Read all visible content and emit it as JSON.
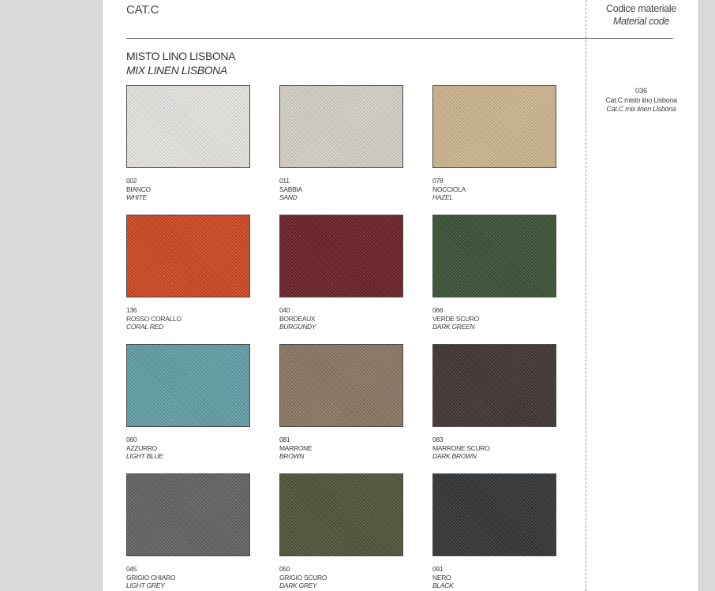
{
  "header": {
    "category": "CAT.C",
    "col_title": "Codice materiale",
    "col_title_en": "Material code"
  },
  "section": {
    "title": "MISTO LINO LISBONA",
    "title_en": "MIX LINEN LISBONA"
  },
  "material_code": {
    "code": "036",
    "name": "Cat.C misto lino Lisbona",
    "name_en": "Cat.C mix linen Lisbona"
  },
  "swatches": [
    {
      "code": "002",
      "name": "BIANCO",
      "name_en": "WHITE",
      "color": "#f1f0ec"
    },
    {
      "code": "011",
      "name": "SABBIA",
      "name_en": "SAND",
      "color": "#dedad0"
    },
    {
      "code": "078",
      "name": "NOCCIOLA",
      "name_en": "HAZEL",
      "color": "#d7bd92"
    },
    {
      "code": "136",
      "name": "ROSSO CORALLO",
      "name_en": "CORAL RED",
      "color": "#d8461e"
    },
    {
      "code": "040",
      "name": "BORDEAUX",
      "name_en": "BURGUNDY",
      "color": "#6e1d26"
    },
    {
      "code": "066",
      "name": "VERDE SCURO",
      "name_en": "DARK GREEN",
      "color": "#3a5234"
    },
    {
      "code": "060",
      "name": "AZZURRO",
      "name_en": "LIGHT BLUE",
      "color": "#64a4ae"
    },
    {
      "code": "081",
      "name": "MARRONE",
      "name_en": "BROWN",
      "color": "#8e7a65"
    },
    {
      "code": "083",
      "name": "MARRONE SCURO",
      "name_en": "DARK BROWN",
      "color": "#3f3330"
    },
    {
      "code": "045",
      "name": "GRIGIO CHIARO",
      "name_en": "LIGHT GREY",
      "color": "#646464"
    },
    {
      "code": "050",
      "name": "GRIGIO SCURO",
      "name_en": "DARK GREY",
      "color": "#4f5637"
    },
    {
      "code": "091",
      "name": "NERO",
      "name_en": "BLACK",
      "color": "#303234"
    }
  ]
}
